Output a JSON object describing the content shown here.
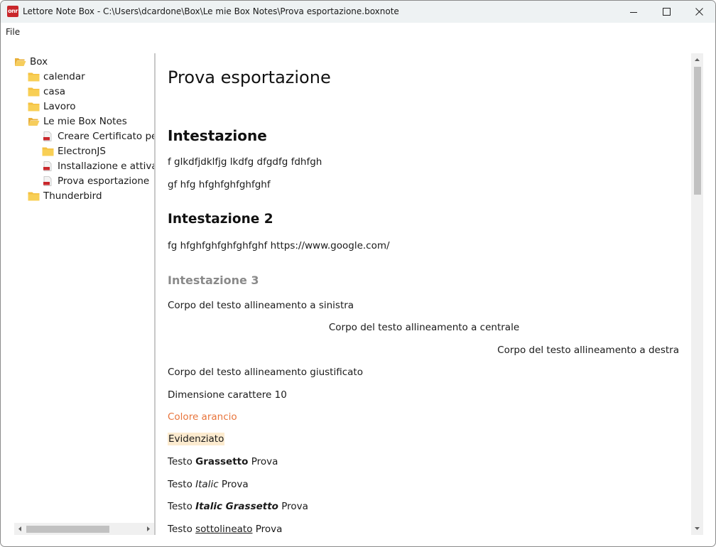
{
  "window": {
    "app_icon_text": "onr",
    "title": "Lettore Note Box - C:\\Users\\dcardone\\Box\\Le mie Box Notes\\Prova esportazione.boxnote"
  },
  "menu": {
    "file": "File"
  },
  "tree": {
    "root": "Box",
    "items": [
      {
        "label": "calendar",
        "icon": "folder-icon"
      },
      {
        "label": "casa",
        "icon": "folder-icon"
      },
      {
        "label": "Lavoro",
        "icon": "folder-icon"
      },
      {
        "label": "Le mie Box Notes",
        "icon": "open-folder-icon"
      },
      {
        "label": "Creare Certificato per l",
        "icon": "boxnote-file-icon"
      },
      {
        "label": "ElectronJS",
        "icon": "folder-icon"
      },
      {
        "label": "Installazione e attivazio",
        "icon": "boxnote-file-icon"
      },
      {
        "label": "Prova esportazione",
        "icon": "boxnote-file-icon"
      },
      {
        "label": "Thunderbird",
        "icon": "folder-icon"
      }
    ]
  },
  "document": {
    "title": "Prova esportazione",
    "h_intestazione": "Intestazione",
    "p1": "f glkdfjdklfjg lkdfg dfgdfg fdhfgh",
    "p2": "gf hfg hfghfghfghfghf",
    "h_intestazione2": "Intestazione 2",
    "p3": "fg hfghfghfghfghfghf https://www.google.com/",
    "h_intestazione3": "Intestazione 3",
    "p_left": "Corpo del testo allineamento a sinistra",
    "p_center": "Corpo del testo allineamento a centrale",
    "p_right": "Corpo del testo allineamento a destra",
    "p_justified": "Corpo del testo allineamento giustificato",
    "p_size10": "Dimensione carattere 10",
    "p_orange": "Colore arancio",
    "p_highlight": "Evidenziato",
    "bold_line": {
      "pre": "Testo ",
      "styled": "Grassetto",
      "post": " Prova"
    },
    "italic_line": {
      "pre": "Testo ",
      "styled": "Italic",
      "post": " Prova"
    },
    "bold_italic_line": {
      "pre": "Testo ",
      "styled": "Italic Grassetto",
      "post": " Prova"
    },
    "underline_line": {
      "pre": "Testo ",
      "styled": "sottolineato",
      "post": " Prova"
    }
  },
  "colors": {
    "orange_text": "#e8743b",
    "highlight": "#fcebcf",
    "heading3": "#8a8a8a",
    "folder": "#f4c142"
  }
}
